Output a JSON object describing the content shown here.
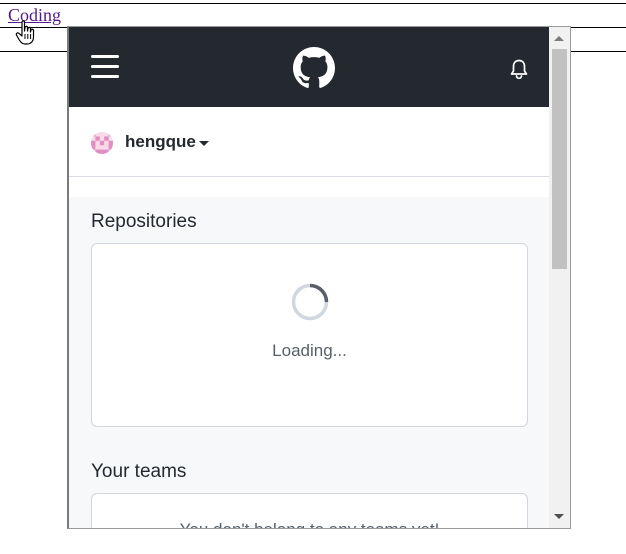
{
  "page": {
    "link_label": "Coding"
  },
  "popup": {
    "header": {
      "menu_icon": "hamburger-menu-icon",
      "logo_icon": "github-octocat-icon",
      "notifications_icon": "bell-icon",
      "background": "#24292f"
    },
    "account": {
      "username": "hengque",
      "avatar": "identicon-avatar"
    },
    "repositories": {
      "title": "Repositories",
      "status": "Loading..."
    },
    "teams": {
      "title": "Your teams",
      "empty_message": "You don't belong to any teams yet!"
    },
    "colors": {
      "accent": "#24292f",
      "avatar_pink": "#e28ec2",
      "link": "#551a8b"
    }
  }
}
